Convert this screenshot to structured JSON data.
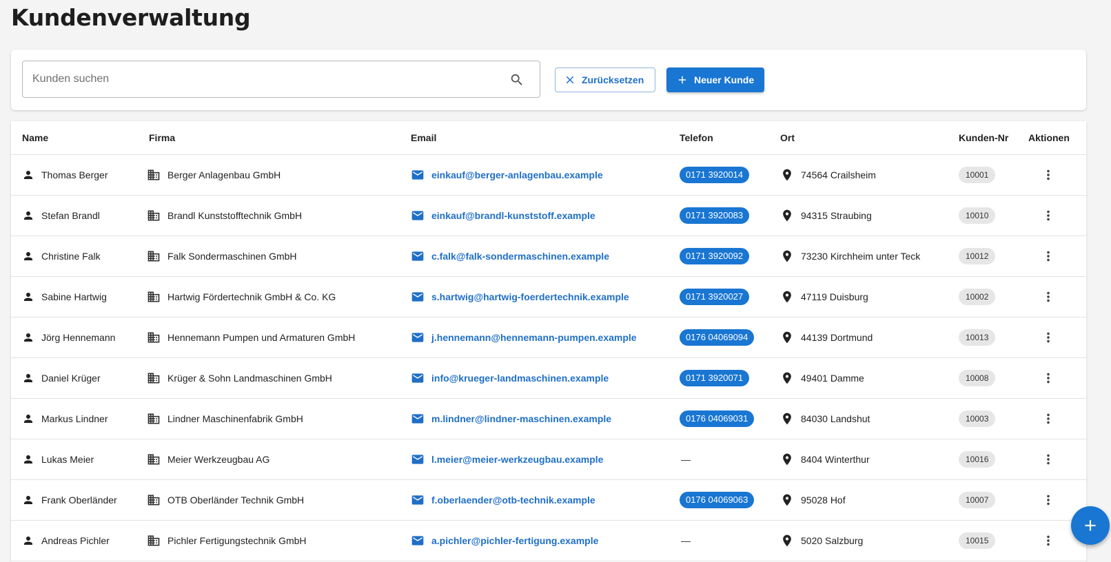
{
  "page": {
    "title": "Kundenverwaltung"
  },
  "toolbar": {
    "search_placeholder": "Kunden suchen",
    "search_value": "",
    "reset_label": "Zurücksetzen",
    "new_label": "Neuer Kunde"
  },
  "table": {
    "columns": {
      "name": "Name",
      "firma": "Firma",
      "email": "Email",
      "telefon": "Telefon",
      "ort": "Ort",
      "kunden_nr": "Kunden-Nr",
      "aktionen": "Aktionen"
    },
    "rows": [
      {
        "name": "Thomas Berger",
        "firma": "Berger Anlagenbau GmbH",
        "email": "einkauf@berger-anlagenbau.example",
        "telefon": "0171 3920014",
        "ort": "74564 Crailsheim",
        "nr": "10001"
      },
      {
        "name": "Stefan Brandl",
        "firma": "Brandl Kunststofftechnik GmbH",
        "email": "einkauf@brandl-kunststoff.example",
        "telefon": "0171 3920083",
        "ort": "94315 Straubing",
        "nr": "10010"
      },
      {
        "name": "Christine Falk",
        "firma": "Falk Sondermaschinen GmbH",
        "email": "c.falk@falk-sondermaschinen.example",
        "telefon": "0171 3920092",
        "ort": "73230 Kirchheim unter Teck",
        "nr": "10012"
      },
      {
        "name": "Sabine Hartwig",
        "firma": "Hartwig Fördertechnik GmbH & Co. KG",
        "email": "s.hartwig@hartwig-foerdertechnik.example",
        "telefon": "0171 3920027",
        "ort": "47119 Duisburg",
        "nr": "10002"
      },
      {
        "name": "Jörg Hennemann",
        "firma": "Hennemann Pumpen und Armaturen GmbH",
        "email": "j.hennemann@hennemann-pumpen.example",
        "telefon": "0176 04069094",
        "ort": "44139 Dortmund",
        "nr": "10013"
      },
      {
        "name": "Daniel Krüger",
        "firma": "Krüger & Sohn Landmaschinen GmbH",
        "email": "info@krueger-landmaschinen.example",
        "telefon": "0171 3920071",
        "ort": "49401 Damme",
        "nr": "10008"
      },
      {
        "name": "Markus Lindner",
        "firma": "Lindner Maschinenfabrik GmbH",
        "email": "m.lindner@lindner-maschinen.example",
        "telefon": "0176 04069031",
        "ort": "84030 Landshut",
        "nr": "10003"
      },
      {
        "name": "Lukas Meier",
        "firma": "Meier Werkzeugbau AG",
        "email": "l.meier@meier-werkzeugbau.example",
        "telefon": "",
        "ort": "8404 Winterthur",
        "nr": "10016"
      },
      {
        "name": "Frank Oberländer",
        "firma": "OTB Oberländer Technik GmbH",
        "email": "f.oberlaender@otb-technik.example",
        "telefon": "0176 04069063",
        "ort": "95028 Hof",
        "nr": "10007"
      },
      {
        "name": "Andreas Pichler",
        "firma": "Pichler Fertigungstechnik GmbH",
        "email": "a.pichler@pichler-fertigung.example",
        "telefon": "",
        "ort": "5020 Salzburg",
        "nr": "10015"
      }
    ],
    "empty_phone": "—"
  },
  "icons": {
    "search": "search-icon",
    "reset": "close-icon",
    "new": "plus-icon",
    "person": "person-icon",
    "company": "building-icon",
    "mail": "mail-icon",
    "location": "location-pin-icon",
    "actions": "more-vert-icon",
    "fab": "plus-icon"
  },
  "colors": {
    "primary": "#1976d2",
    "link": "#1f6fc8",
    "chip_gray": "#e6e6e6",
    "background": "#f4f4f4"
  }
}
